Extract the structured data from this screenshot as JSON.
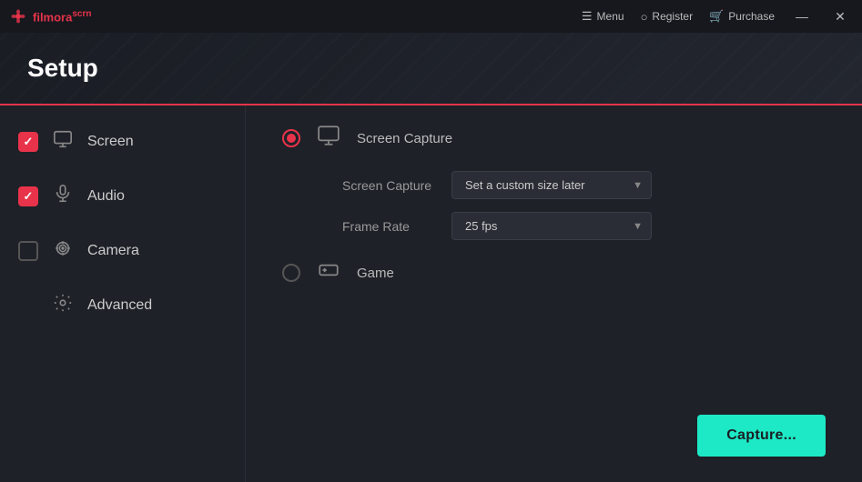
{
  "app": {
    "name": "filmora",
    "name_highlight": "scrn",
    "title": "Setup"
  },
  "titlebar": {
    "menu_label": "Menu",
    "register_label": "Register",
    "purchase_label": "Purchase",
    "minimize_icon": "—",
    "close_icon": "✕"
  },
  "sidebar": {
    "items": [
      {
        "id": "screen",
        "label": "Screen",
        "checked": true
      },
      {
        "id": "audio",
        "label": "Audio",
        "checked": true
      },
      {
        "id": "camera",
        "label": "Camera",
        "checked": false
      },
      {
        "id": "advanced",
        "label": "Advanced",
        "checked": null
      }
    ]
  },
  "content": {
    "options": [
      {
        "id": "screen-capture",
        "label": "Screen Capture",
        "selected": true,
        "fields": [
          {
            "id": "screen-capture-size",
            "label": "Screen Capture",
            "value": "Set a custom size later"
          },
          {
            "id": "frame-rate",
            "label": "Frame Rate",
            "value": "25 fps"
          }
        ]
      },
      {
        "id": "game",
        "label": "Game",
        "selected": false,
        "fields": []
      }
    ],
    "capture_btn": "Capture..."
  }
}
